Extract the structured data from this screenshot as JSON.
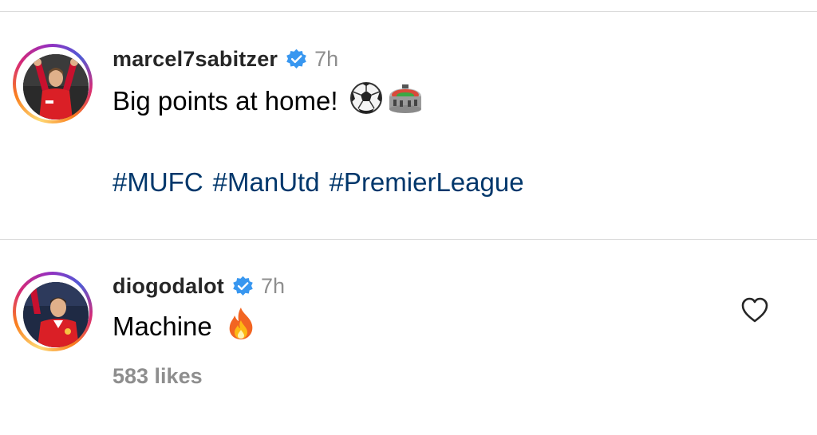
{
  "comments": [
    {
      "username": "marcel7sabitzer",
      "verified": true,
      "time": "7h",
      "text": "Big points at home!",
      "emojis": [
        "soccer-ball-emoji",
        "stadium-emoji"
      ],
      "hashtags": [
        "#MUFC",
        "#ManUtd",
        "#PremierLeague"
      ]
    },
    {
      "username": "diogodalot",
      "verified": true,
      "time": "7h",
      "text": "Machine",
      "emojis": [
        "fire-emoji"
      ],
      "likes": "583 likes"
    }
  ],
  "colors": {
    "username": "#262626",
    "meta": "#8e8e8e",
    "hashtag": "#00376b",
    "verified": "#3897f0",
    "divider": "#dbdbdb"
  }
}
